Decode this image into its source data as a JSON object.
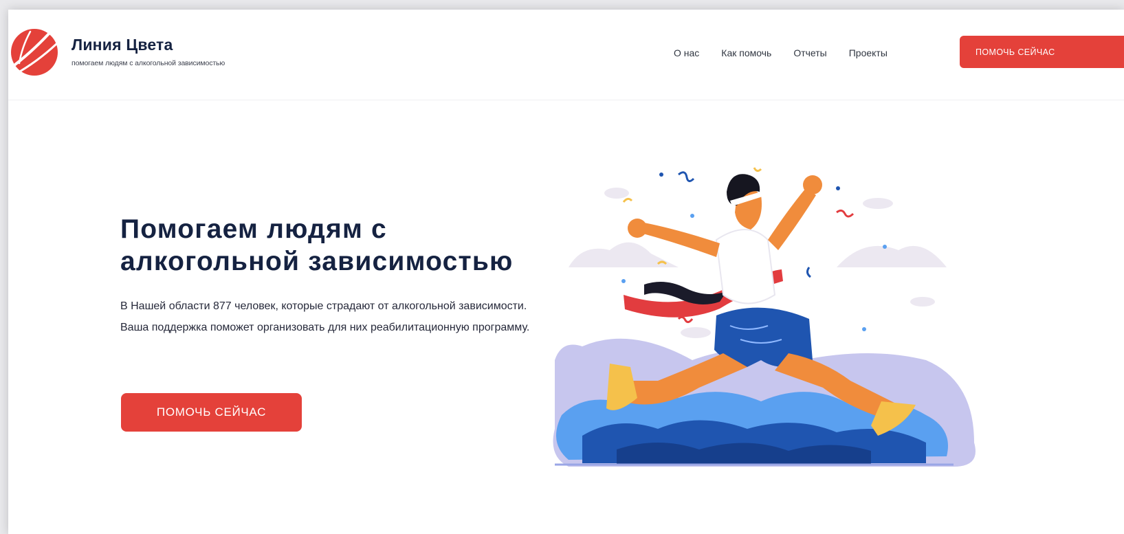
{
  "brand": {
    "name": "Линия Цвета",
    "tagline": "помогаем людям с алкогольной зависимостью"
  },
  "nav": {
    "items": [
      {
        "label": "О нас"
      },
      {
        "label": "Как помочь"
      },
      {
        "label": "Отчеты"
      },
      {
        "label": "Проекты"
      }
    ],
    "cta_label": "ПОМОЧЬ СЕЙЧАС"
  },
  "hero": {
    "title_line1": "Помогаем людям с",
    "title_line2": "алкогольной зависимостью",
    "text": "В Нашей области 877 человек, которые страдают от алкогольной зависимости. Ваша поддержка поможет организовать для них реабилитационную программу.",
    "cta_label": "ПОМОЧЬ СЕЙЧАС"
  },
  "colors": {
    "accent": "#e4413a",
    "heading": "#152241",
    "illustration_blue": "#1f55b0"
  },
  "icons": {
    "logo": "brand-logo-icon",
    "illustration": "runner-finish-line-illustration"
  }
}
